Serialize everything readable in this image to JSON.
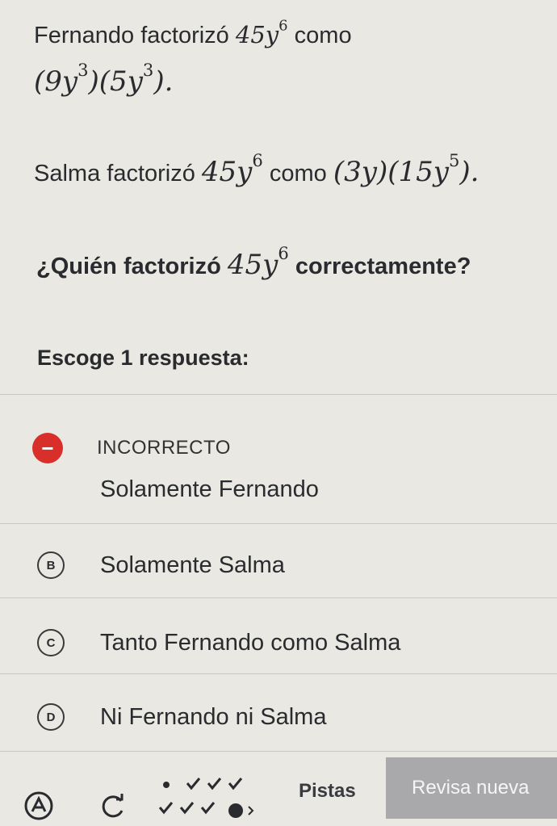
{
  "statements": {
    "s1_text_before": "Fernando factorizó",
    "s1_expr_base": "45y",
    "s1_expr_exp": "6",
    "s1_text_after": "como",
    "s1_factor1_base": "(9y",
    "s1_factor1_exp": "3",
    "s1_factor2_base": ")(5y",
    "s1_factor2_exp": "3",
    "s1_end": ").",
    "s2_text_before": "Salma factorizó",
    "s2_expr_base": "45y",
    "s2_expr_exp": "6",
    "s2_text_after": "como",
    "s2_factors_base": "(3y)(15y",
    "s2_factors_exp": "5",
    "s2_end": ")."
  },
  "question": {
    "text_before": "¿Quién factorizó",
    "expr_base": "45y",
    "expr_exp": "6",
    "text_after": "correctamente?"
  },
  "prompt": "Escoge 1 respuesta:",
  "feedback": {
    "icon": "minus-icon",
    "symbol": "−",
    "text": "INCORRECTO",
    "color": "#d92f2a"
  },
  "options": [
    {
      "letter": "",
      "label": "Solamente Fernando",
      "selected": true
    },
    {
      "letter": "B",
      "label": "Solamente Salma"
    },
    {
      "letter": "C",
      "label": "Tanto Fernando como Salma"
    },
    {
      "letter": "D",
      "label": "Ni Fernando ni Salma"
    }
  ],
  "footer": {
    "hints_label": "Pistas",
    "check_label": "Revisa nueva"
  }
}
